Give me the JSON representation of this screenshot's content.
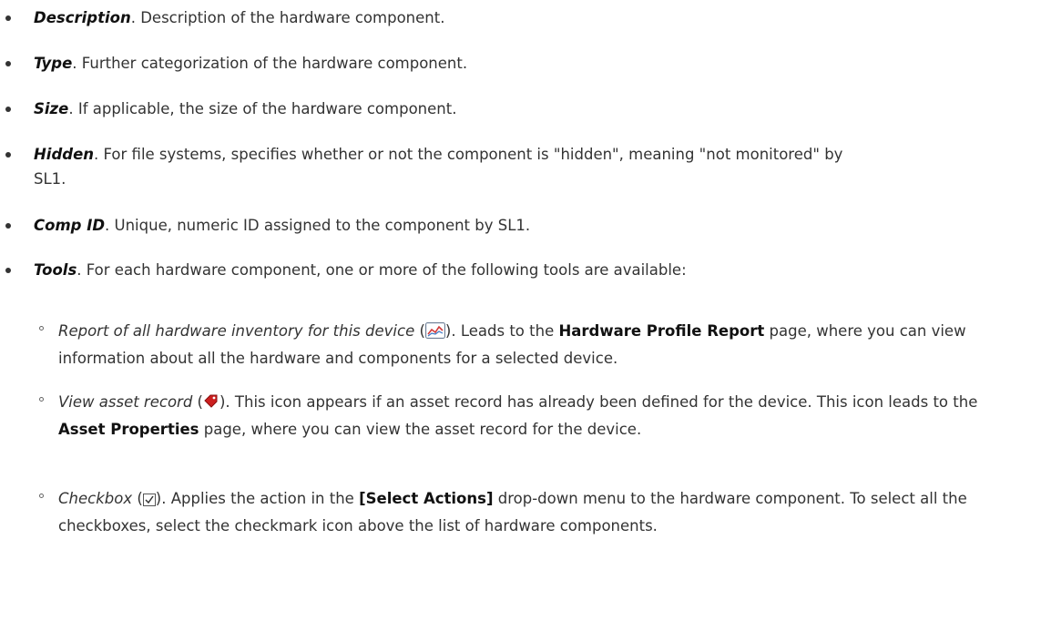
{
  "items": [
    {
      "term": "Description",
      "text": ". Description of the hardware component."
    },
    {
      "term": "Type",
      "text": ". Further categorization of the hardware component."
    },
    {
      "term": "Size",
      "text": ". If applicable, the size of the hardware component."
    },
    {
      "term": "Hidden",
      "text": ". For file systems, specifies whether or not the component is \"hidden\", meaning \"not monitored\" by SL1."
    },
    {
      "term": "Comp ID",
      "text": ". Unique, numeric ID assigned to the component by SL1."
    },
    {
      "term": "Tools",
      "text": ". For each hardware component, one or more of the following tools are available:"
    }
  ],
  "tools": [
    {
      "name": "Report of all hardware inventory for this device",
      "icon": "report-chart-icon",
      "open_paren": " (",
      "mid": "). Leads to the ",
      "ui": "Hardware Profile Report",
      "rest": " page, where you can view information about all the hardware and components for a selected device."
    },
    {
      "name": "View asset record",
      "icon": "asset-tag-icon",
      "open_paren": " (",
      "mid": "). This icon appears if an asset record has already been defined for the device. This icon leads to the ",
      "ui": "Asset Properties",
      "rest": " page, where you can view the asset record for the device."
    },
    {
      "name": "Checkbox",
      "icon": "checkbox-icon",
      "open_paren": " (",
      "mid": "). Applies the action in the ",
      "ui": "[Select Actions]",
      "rest": " drop-down menu to the hardware component. To select all the checkboxes, select the checkmark icon above the list of hardware components."
    }
  ],
  "colors": {
    "text": "#333333",
    "tag_red": "#cc1f1f"
  }
}
